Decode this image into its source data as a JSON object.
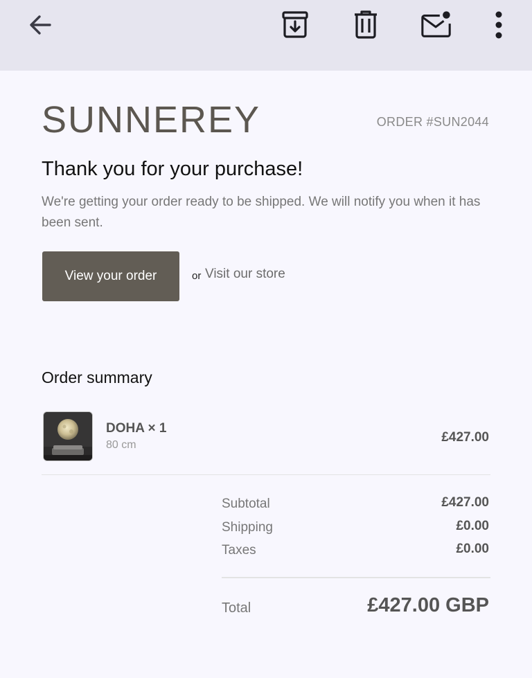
{
  "toolbar": {
    "back_icon": "arrow-left-icon",
    "archive_icon": "archive-icon",
    "delete_icon": "trash-icon",
    "mark_unread_icon": "mail-unread-icon",
    "more_icon": "more-vert-icon"
  },
  "email": {
    "brand": "SUNNEREY",
    "order_number": "ORDER #SUN2044",
    "headline": "Thank you for your purchase!",
    "message": "We're getting your order ready to be shipped. We will notify you when it has been sent.",
    "view_order_label": "View your order",
    "or_text": "or",
    "store_link_label": "Visit our store"
  },
  "summary": {
    "title": "Order summary",
    "items": [
      {
        "name": "DOHA × 1",
        "variant": "80 cm",
        "price": "£427.00"
      }
    ],
    "subtotal_label": "Subtotal",
    "subtotal_value": "£427.00",
    "shipping_label": "Shipping",
    "shipping_value": "£0.00",
    "taxes_label": "Taxes",
    "taxes_value": "£0.00",
    "total_label": "Total",
    "total_value": "£427.00 GBP"
  },
  "colors": {
    "topbar_bg": "#e6e5ef",
    "page_bg": "#f8f7fe",
    "brand": "#5c5750",
    "button_bg": "#625d55"
  }
}
